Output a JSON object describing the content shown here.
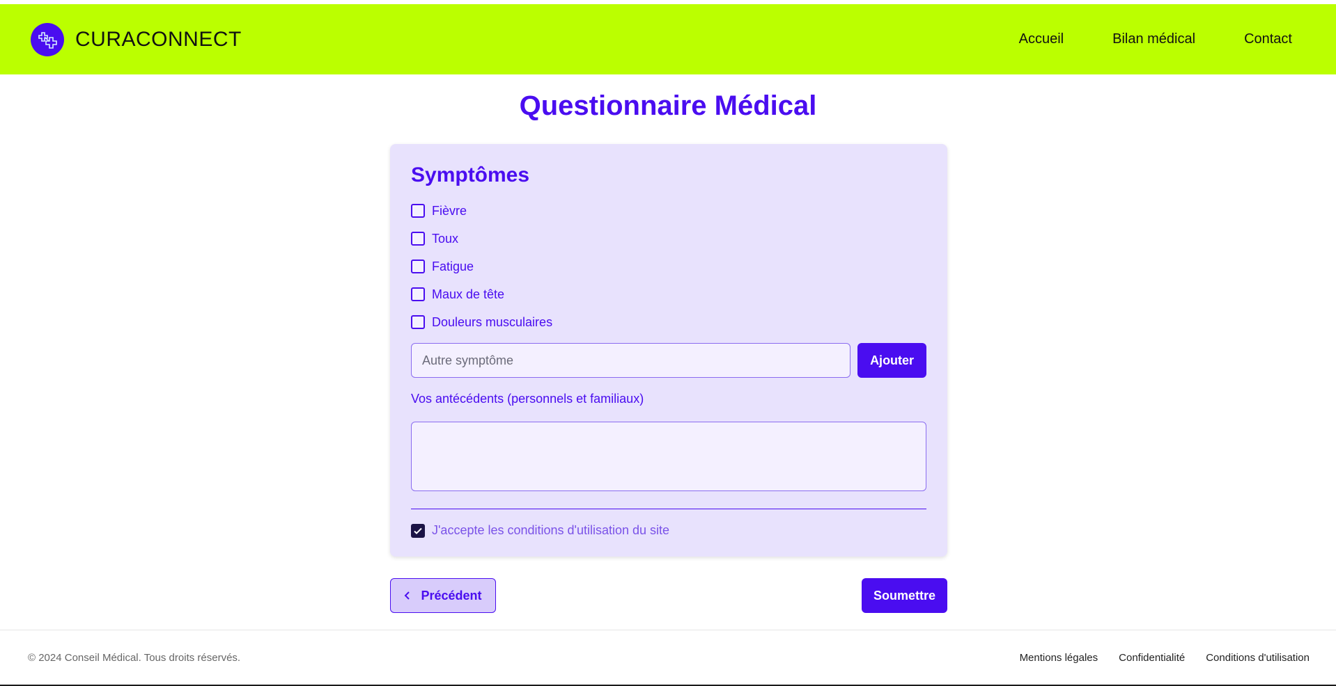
{
  "header": {
    "brand": "CURACONNECT",
    "nav": [
      "Accueil",
      "Bilan médical",
      "Contact"
    ]
  },
  "page_title": "Questionnaire Médical",
  "form": {
    "section_title": "Symptômes",
    "symptoms": [
      "Fièvre",
      "Toux",
      "Fatigue",
      "Maux de tête",
      "Douleurs musculaires"
    ],
    "other_symptom_placeholder": "Autre symptôme",
    "add_label": "Ajouter",
    "history_label": "Vos antécédents (personnels et familiaux)",
    "terms_label": "J'accepte les conditions d'utilisation du site",
    "terms_checked": true
  },
  "buttons": {
    "previous": "Précédent",
    "submit": "Soumettre"
  },
  "footer": {
    "copyright": "© 2024 Conseil Médical. Tous droits réservés.",
    "links": [
      "Mentions légales",
      "Confidentialité",
      "Conditions d'utilisation"
    ]
  },
  "colors": {
    "header_bg": "#bbff00",
    "accent": "#4a0df0",
    "card_bg": "#e8e2fd"
  }
}
